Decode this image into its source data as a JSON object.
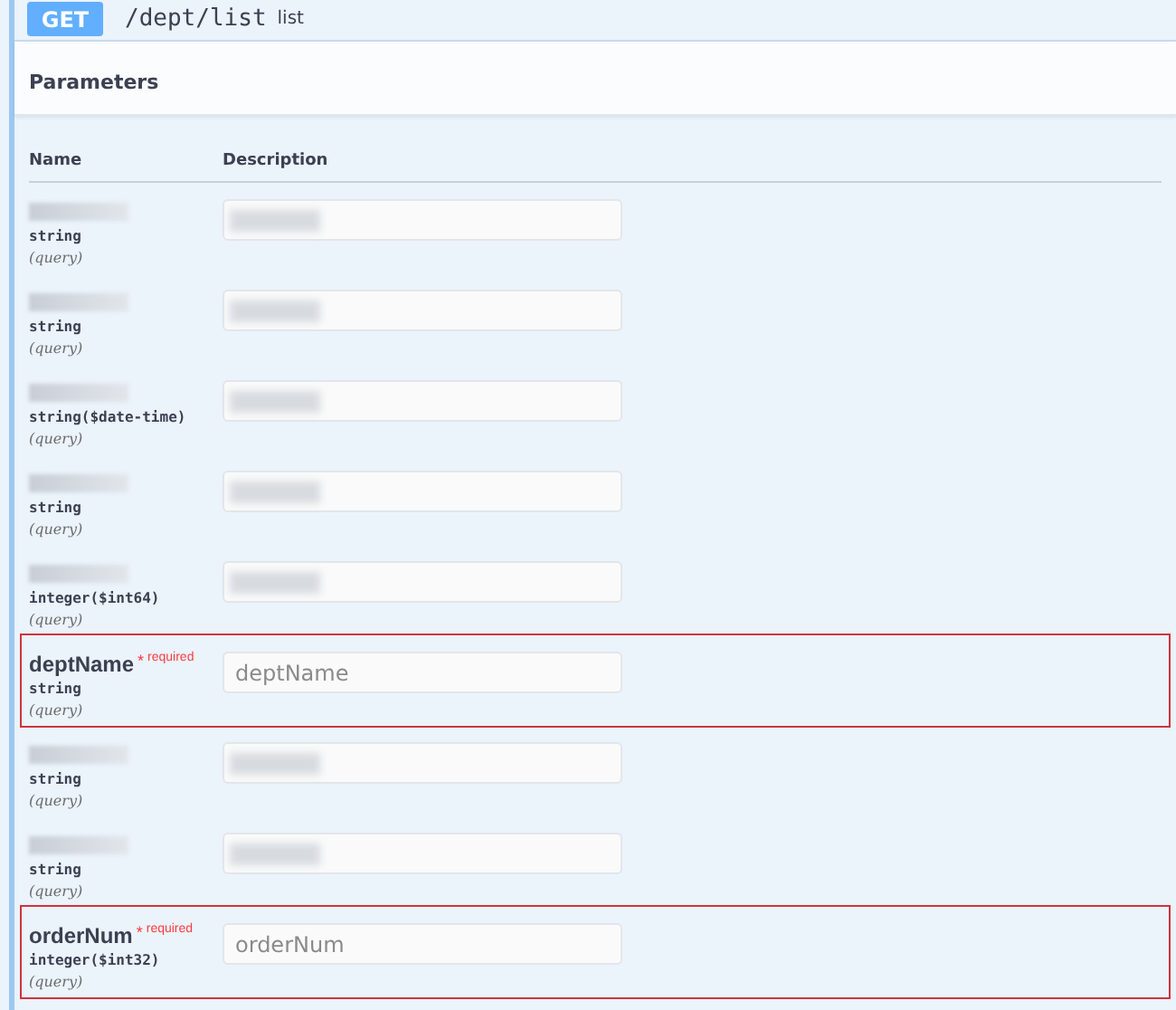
{
  "operation": {
    "method": "GET",
    "path": "/dept/list",
    "summary": "list"
  },
  "section_title": "Parameters",
  "columns": [
    "Name",
    "Description"
  ],
  "parameters": [
    {
      "redacted": true,
      "highlighted": false,
      "type": "string",
      "location": "(query)"
    },
    {
      "redacted": true,
      "highlighted": false,
      "type": "string",
      "location": "(query)"
    },
    {
      "redacted": true,
      "highlighted": false,
      "type": "string($date-time)",
      "location": "(query)"
    },
    {
      "redacted": true,
      "highlighted": false,
      "type": "string",
      "location": "(query)"
    },
    {
      "redacted": true,
      "highlighted": false,
      "type": "integer($int64)",
      "location": "(query)"
    },
    {
      "redacted": false,
      "highlighted": true,
      "name": "deptName",
      "required_mark": "*",
      "required_label": "required",
      "type": "string",
      "location": "(query)",
      "placeholder": "deptName"
    },
    {
      "redacted": true,
      "highlighted": false,
      "type": "string",
      "location": "(query)"
    },
    {
      "redacted": true,
      "highlighted": false,
      "type": "string",
      "location": "(query)"
    },
    {
      "redacted": false,
      "highlighted": true,
      "name": "orderNum",
      "required_mark": "*",
      "required_label": "required",
      "type": "integer($int32)",
      "location": "(query)",
      "placeholder": "orderNum"
    }
  ]
}
